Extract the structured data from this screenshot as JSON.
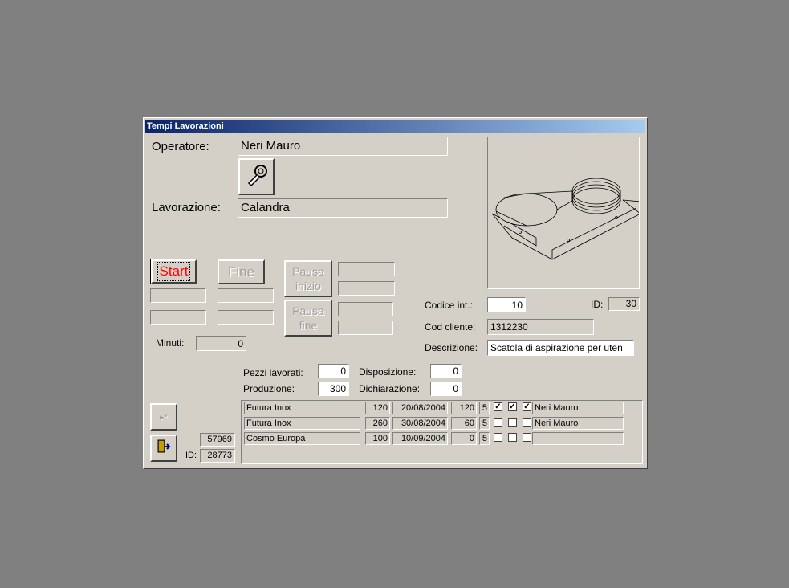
{
  "window": {
    "title": "Tempi Lavorazioni"
  },
  "form": {
    "operatore_label": "Operatore:",
    "operatore_value": "Neri Mauro",
    "lavorazione_label": "Lavorazione:",
    "lavorazione_value": "Calandra",
    "start_label": "Start",
    "fine_label": "Fine",
    "pausa_inizio_label_1": "Pausa",
    "pausa_inizio_label_2": "inizio",
    "pausa_fine_label_1": "Pausa",
    "pausa_fine_label_2": "fine",
    "minuti_label": "Minuti:",
    "minuti_value": "0",
    "codice_int_label": "Codice  int.:",
    "codice_int_value": "10",
    "id_label": "ID:",
    "id_value": "30",
    "cod_cliente_label": "Cod cliente:",
    "cod_cliente_value": "1312230",
    "descrizione_label": "Descrizione:",
    "descrizione_value": "Scatola di aspirazione per uten",
    "pezzi_label": "Pezzi lavorati:",
    "pezzi_value": "0",
    "produzione_label": "Produzione:",
    "produzione_value": "300",
    "disposizione_label": "Disposizione:",
    "disposizione_value": "0",
    "dichiarazione_label": "Dichiarazione:",
    "dichiarazione_value": "0",
    "record_count": "57969",
    "bottom_id_label": "ID:",
    "bottom_id_value": "28773"
  },
  "icons": {
    "tool": "wrench-icon",
    "new_record": "new-record-icon",
    "exit": "exit-door-icon",
    "drawing": "technical-drawing"
  },
  "rows": [
    {
      "cliente": "Futura Inox",
      "qty": "120",
      "data": "20/08/2004",
      "prod": "120",
      "n": "5",
      "checks": [
        true,
        true,
        true
      ],
      "operatore": "Neri Mauro"
    },
    {
      "cliente": "Futura Inox",
      "qty": "260",
      "data": "30/08/2004",
      "prod": "60",
      "n": "5",
      "checks": [
        false,
        false,
        false
      ],
      "operatore": "Neri Mauro"
    },
    {
      "cliente": "Cosmo Europa",
      "qty": "100",
      "data": "10/09/2004",
      "prod": "0",
      "n": "5",
      "checks": [
        false,
        false,
        false
      ],
      "operatore": ""
    }
  ]
}
